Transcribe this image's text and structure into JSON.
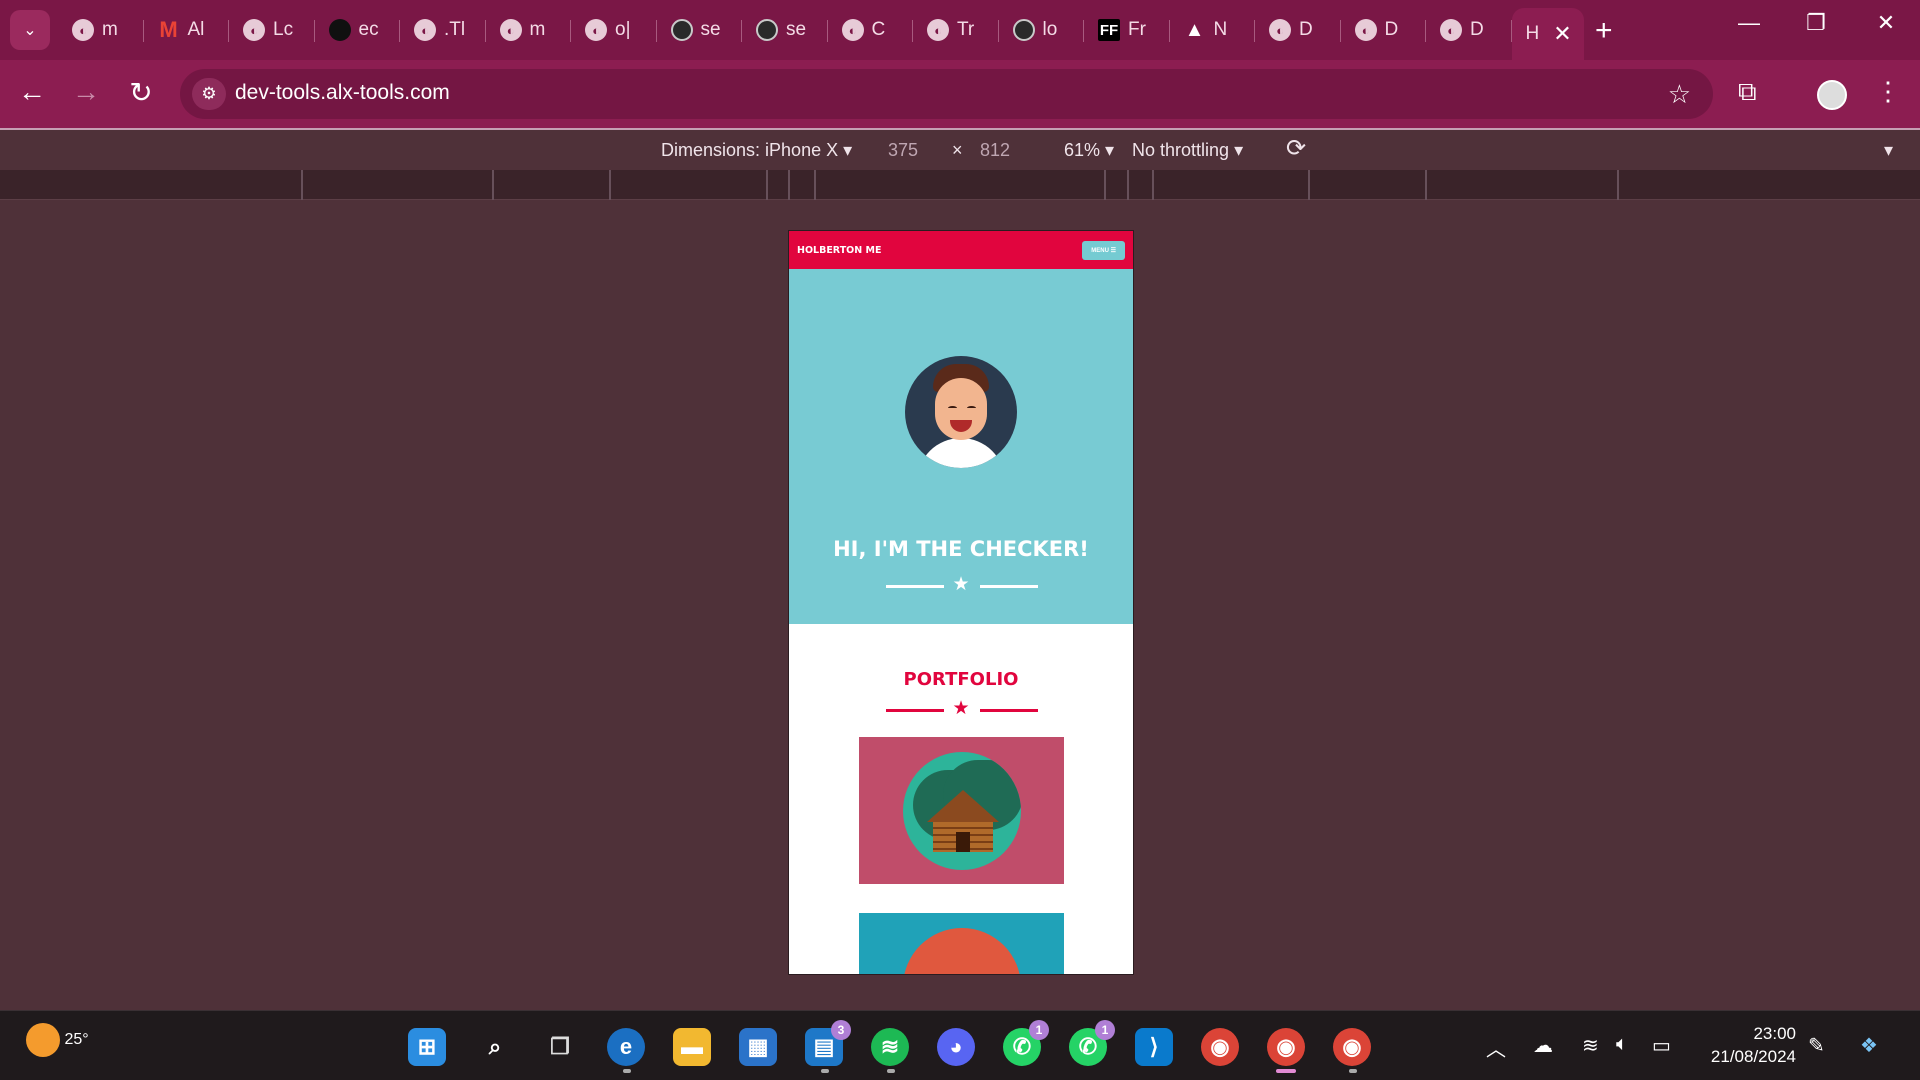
{
  "browser": {
    "tabs": [
      {
        "label": "m",
        "favicon": "globe-icon"
      },
      {
        "label": "Al",
        "favicon": "gmail-icon"
      },
      {
        "label": "Lc",
        "favicon": "globe-icon"
      },
      {
        "label": "ec",
        "favicon": "github-icon"
      },
      {
        "label": ".Tl",
        "favicon": "globe-icon"
      },
      {
        "label": "m",
        "favicon": "globe-icon"
      },
      {
        "label": "o|",
        "favicon": "globe-icon"
      },
      {
        "label": "se",
        "favicon": "circle-icon"
      },
      {
        "label": "se",
        "favicon": "circle-icon"
      },
      {
        "label": "C",
        "favicon": "globe-icon"
      },
      {
        "label": "Tr",
        "favicon": "globe-icon"
      },
      {
        "label": "lo",
        "favicon": "circle-icon"
      },
      {
        "label": "Fr",
        "favicon": "ff-icon"
      },
      {
        "label": "N",
        "favicon": "triangle-icon"
      },
      {
        "label": "D",
        "favicon": "globe-icon"
      },
      {
        "label": "D",
        "favicon": "globe-icon"
      },
      {
        "label": "D",
        "favicon": "globe-icon"
      }
    ],
    "active_tab": {
      "label": "H"
    },
    "url": "dev-tools.alx-tools.com"
  },
  "devtools": {
    "dimensions_label": "Dimensions: iPhone X",
    "width": "375",
    "times": "×",
    "height": "812",
    "zoom": "61%",
    "throttling": "No throttling"
  },
  "page": {
    "brand": "HOLBERTON ME",
    "menu_label": "MENU ☰",
    "hero_title": "HI, I'M THE CHECKER!",
    "section_title": "PORTFOLIO"
  },
  "taskbar": {
    "temperature": "25°",
    "badges": {
      "tasks": "3",
      "whatsapp1": "1",
      "whatsapp2": "1"
    },
    "time": "23:00",
    "date": "21/08/2024"
  },
  "colors": {
    "accent": "#e1053e",
    "hero": "#78cbd3",
    "browser_frame": "#8c1d51",
    "card1": "#c04d6a",
    "card2": "#20a2b8"
  }
}
